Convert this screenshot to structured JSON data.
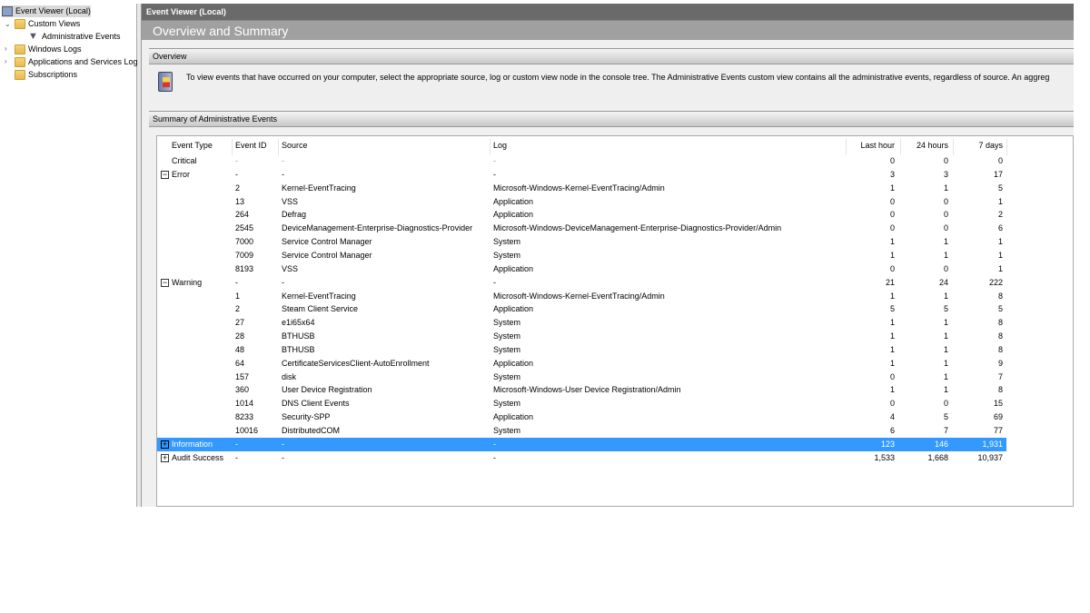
{
  "tree": {
    "root": "Event Viewer (Local)",
    "custom_views": "Custom Views",
    "admin_events": "Administrative Events",
    "windows_logs": "Windows Logs",
    "apps_services": "Applications and Services Log",
    "subscriptions": "Subscriptions"
  },
  "header": {
    "title": "Event Viewer (Local)",
    "page_title": "Overview and Summary"
  },
  "overview": {
    "heading": "Overview",
    "text": "To view events that have occurred on your computer, select the appropriate source, log or custom view node in the console tree. The Administrative Events custom view contains all the administrative events, regardless of source. An aggreg"
  },
  "summary": {
    "heading": "Summary of Administrative Events",
    "columns": [
      "Event Type",
      "Event ID",
      "Source",
      "Log",
      "Last hour",
      "24 hours",
      "7 days"
    ],
    "rows": [
      [
        "Critical",
        "-",
        "-",
        "-",
        "0",
        "0",
        "0"
      ],
      [
        "Error",
        "-",
        "-",
        "-",
        "3",
        "3",
        "17"
      ],
      [
        "",
        "2",
        "Kernel-EventTracing",
        "Microsoft-Windows-Kernel-EventTracing/Admin",
        "1",
        "1",
        "5"
      ],
      [
        "",
        "13",
        "VSS",
        "Application",
        "0",
        "0",
        "1"
      ],
      [
        "",
        "264",
        "Defrag",
        "Application",
        "0",
        "0",
        "2"
      ],
      [
        "",
        "2545",
        "DeviceManagement-Enterprise-Diagnostics-Provider",
        "Microsoft-Windows-DeviceManagement-Enterprise-Diagnostics-Provider/Admin",
        "0",
        "0",
        "6"
      ],
      [
        "",
        "7000",
        "Service Control Manager",
        "System",
        "1",
        "1",
        "1"
      ],
      [
        "",
        "7009",
        "Service Control Manager",
        "System",
        "1",
        "1",
        "1"
      ],
      [
        "",
        "8193",
        "VSS",
        "Application",
        "0",
        "0",
        "1"
      ],
      [
        "Warning",
        "-",
        "-",
        "-",
        "21",
        "24",
        "222"
      ],
      [
        "",
        "1",
        "Kernel-EventTracing",
        "Microsoft-Windows-Kernel-EventTracing/Admin",
        "1",
        "1",
        "8"
      ],
      [
        "",
        "2",
        "Steam Client Service",
        "Application",
        "5",
        "5",
        "5"
      ],
      [
        "",
        "27",
        "e1i65x64",
        "System",
        "1",
        "1",
        "8"
      ],
      [
        "",
        "28",
        "BTHUSB",
        "System",
        "1",
        "1",
        "8"
      ],
      [
        "",
        "48",
        "BTHUSB",
        "System",
        "1",
        "1",
        "8"
      ],
      [
        "",
        "64",
        "CertificateServicesClient-AutoEnrollment",
        "Application",
        "1",
        "1",
        "9"
      ],
      [
        "",
        "157",
        "disk",
        "System",
        "0",
        "1",
        "7"
      ],
      [
        "",
        "360",
        "User Device Registration",
        "Microsoft-Windows-User Device Registration/Admin",
        "1",
        "1",
        "8"
      ],
      [
        "",
        "1014",
        "DNS Client Events",
        "System",
        "0",
        "0",
        "15"
      ],
      [
        "",
        "8233",
        "Security-SPP",
        "Application",
        "4",
        "5",
        "69"
      ],
      [
        "",
        "10016",
        "DistributedCOM",
        "System",
        "6",
        "7",
        "77"
      ],
      [
        "Information",
        "-",
        "-",
        "-",
        "123",
        "146",
        "1,931"
      ],
      [
        "Audit Success",
        "-",
        "-",
        "-",
        "1,533",
        "1,668",
        "10,937"
      ]
    ],
    "groups": {
      "Error": "expanded",
      "Warning": "expanded",
      "Information": "collapsed",
      "Audit Success": "collapsed"
    },
    "selected_row": "Information"
  }
}
